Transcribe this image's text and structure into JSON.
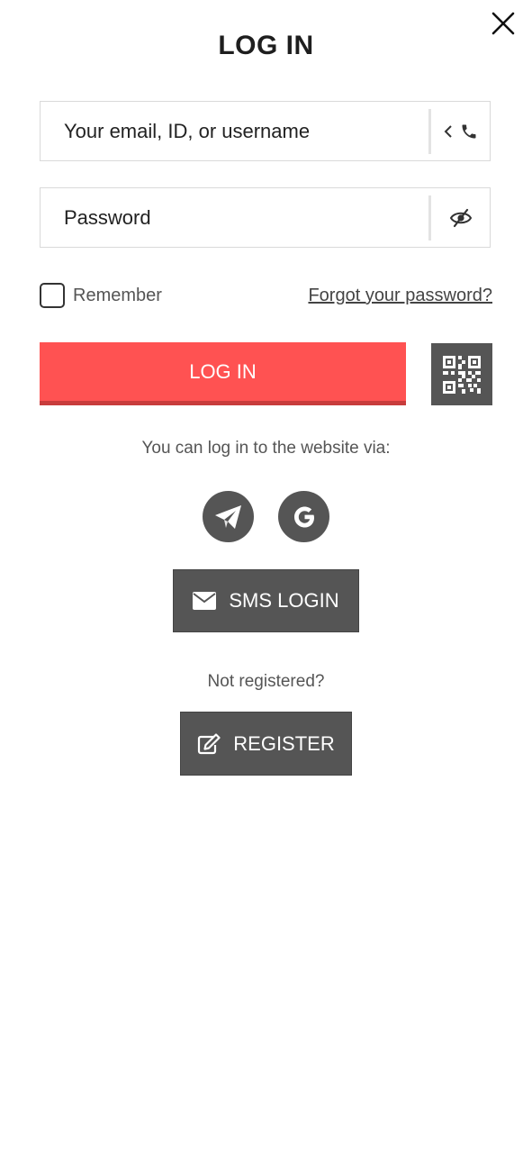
{
  "title": "LOG IN",
  "close_icon": "close-icon",
  "email_field": {
    "placeholder": "Your email, ID, or username",
    "value": "",
    "trailing_icons": [
      "chevron-left-icon",
      "phone-icon"
    ]
  },
  "password_field": {
    "placeholder": "Password",
    "value": "",
    "trailing_icon": "eye-slash-icon"
  },
  "remember": {
    "label": "Remember",
    "checked": false
  },
  "forgot_password_label": "Forgot your password?",
  "login_button_label": "LOG IN",
  "qr_icon": "qr-code-icon",
  "via_text": "You can log in to the website via:",
  "social_icons": [
    "telegram-icon",
    "google-icon"
  ],
  "sms_login_label": "SMS LOGIN",
  "not_registered_text": "Not registered?",
  "register_label": "REGISTER",
  "colors": {
    "accent": "#ff5252",
    "accent_dark": "#c83c3c",
    "button_dark": "#555555",
    "text": "#222222",
    "muted": "#555555"
  }
}
